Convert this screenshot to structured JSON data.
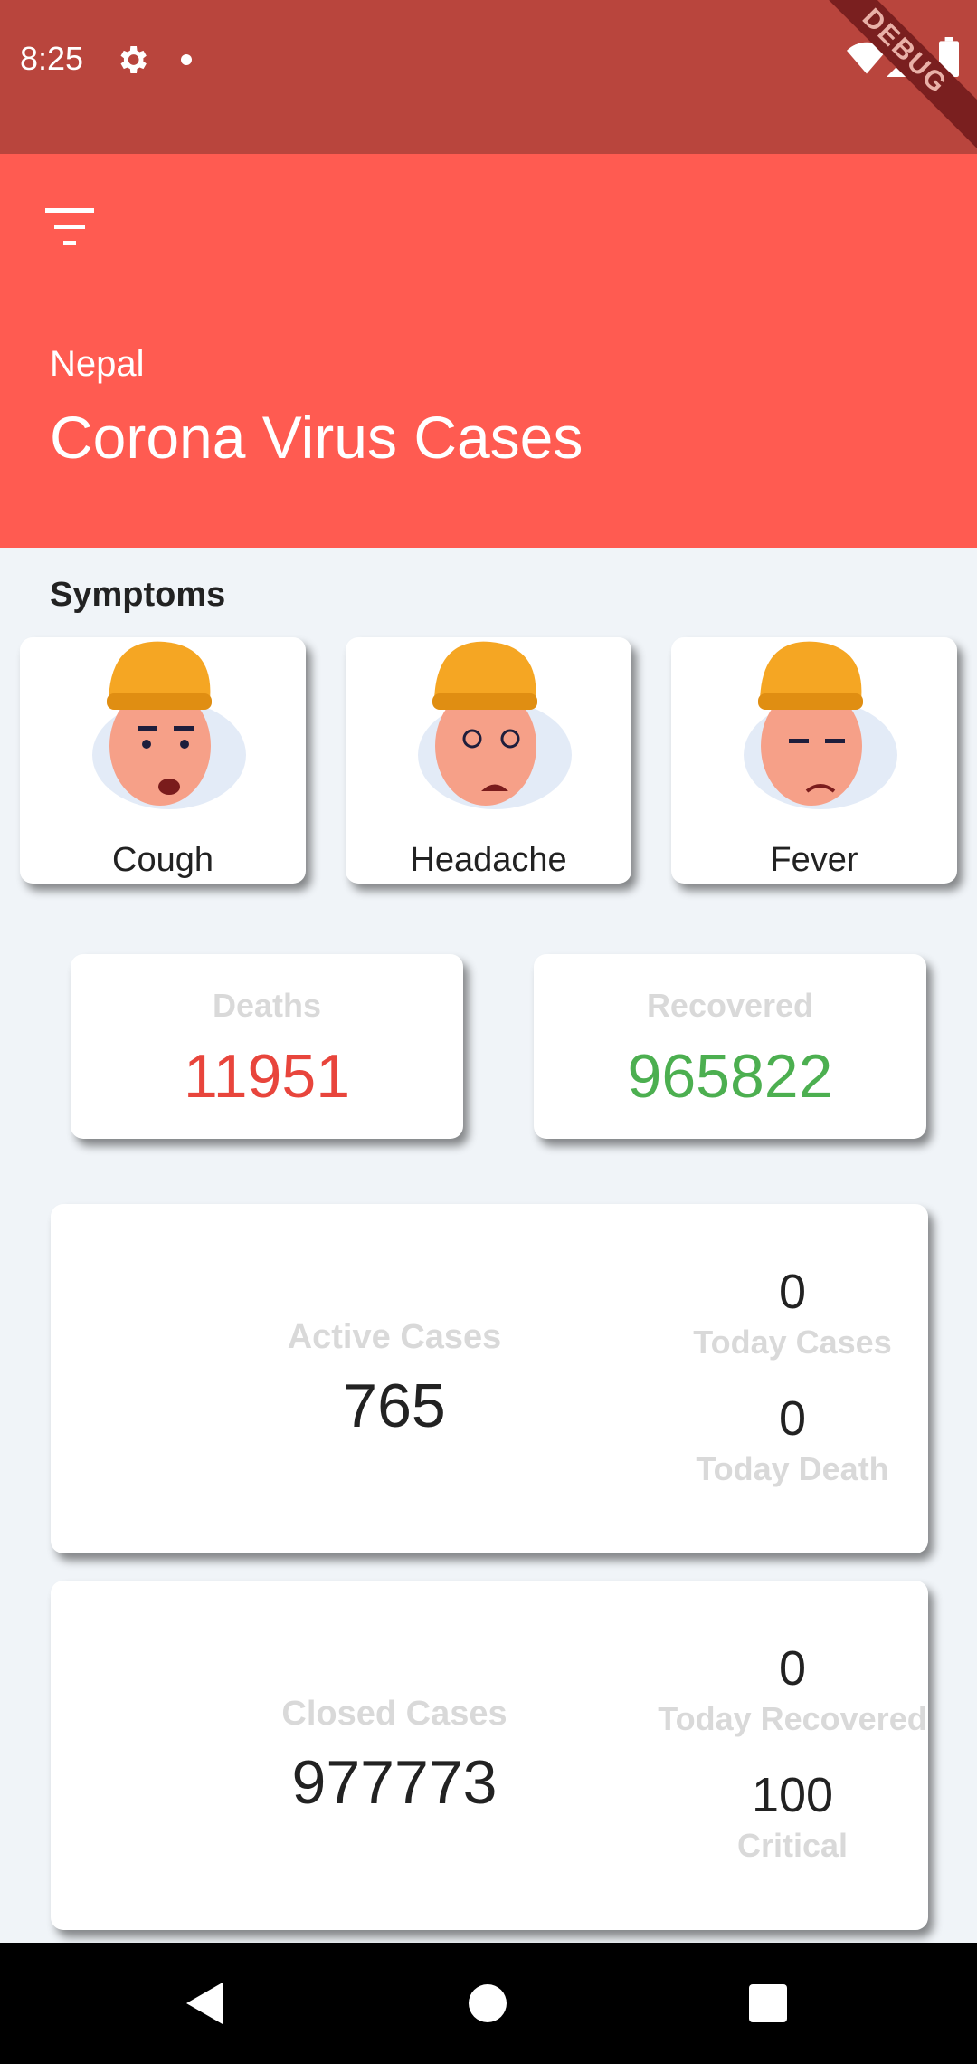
{
  "status_bar": {
    "time": "8:25",
    "debug_label": "DEBUG",
    "icons": [
      "gear-icon",
      "notification-dot-icon",
      "wifi-icon",
      "signal-icon",
      "battery-icon"
    ]
  },
  "header": {
    "menu_icon": "filter-menu-icon",
    "subtitle": "Nepal",
    "title": "Corona Virus Cases"
  },
  "symptoms": {
    "title": "Symptoms",
    "items": [
      {
        "label": "Cough"
      },
      {
        "label": "Headache"
      },
      {
        "label": "Fever"
      }
    ]
  },
  "stats": {
    "deaths": {
      "label": "Deaths",
      "value": "11951",
      "color": "#e8453c"
    },
    "recovered": {
      "label": "Recovered",
      "value": "965822",
      "color": "#4caf50"
    }
  },
  "active": {
    "label": "Active Cases",
    "value": "765",
    "today_cases_value": "0",
    "today_cases_label": "Today Cases",
    "today_death_value": "0",
    "today_death_label": "Today Death"
  },
  "closed": {
    "label": "Closed Cases",
    "value": "977773",
    "today_recovered_value": "0",
    "today_recovered_label": "Today Recovered",
    "critical_value": "100",
    "critical_label": "Critical"
  },
  "colors": {
    "status_bar": "#b9453d",
    "header": "#ff5b51",
    "background": "#f0f4f8"
  }
}
